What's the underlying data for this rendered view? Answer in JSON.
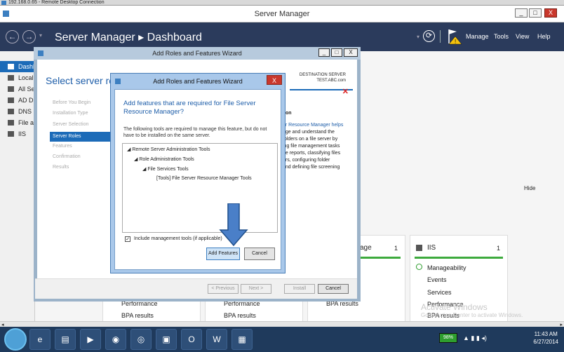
{
  "rdc": {
    "title": "192.168.0.65 - Remote Desktop Connection"
  },
  "window": {
    "title": "Server Manager",
    "min": "_",
    "max": "□",
    "close": "X"
  },
  "header": {
    "breadcrumb": "Server Manager ▸ Dashboard",
    "refresh_symbol": "⟳",
    "menu": [
      "Manage",
      "Tools",
      "View",
      "Help"
    ]
  },
  "sidebar": {
    "items": [
      "Dashboard",
      "Local Server",
      "All Servers",
      "AD DS",
      "DNS",
      "File and Storage Services",
      "IIS"
    ]
  },
  "main": {
    "hide": "Hide",
    "tiles": [
      {
        "title": "IIS",
        "count": "1",
        "rows": [
          "Manageability",
          "Events",
          "Services",
          "Performance",
          "BPA results"
        ]
      },
      {
        "title": "age",
        "count": "1"
      }
    ],
    "bottom_rows": [
      "Performance",
      "BPA results",
      "Performance",
      "BPA results",
      "BPA results"
    ]
  },
  "wizard": {
    "title": "Add Roles and Features Wizard",
    "heading": "Select server roles",
    "dest_label": "DESTINATION SERVER",
    "dest_value": "TEST.ABC.com",
    "steps": [
      "Before You Begin",
      "Installation Type",
      "Server Selection",
      "Server Roles",
      "Features",
      "Confirmation",
      "Results"
    ],
    "desc_heading": "ion",
    "desc_lines": [
      "er Resource Manager helps",
      "age and understand the",
      "folders on a file server by",
      "ing file management tasks",
      "ge reports, classifying files",
      "ers, configuring folder",
      "and defining file screening"
    ],
    "buttons": {
      "prev": "< Previous",
      "next": "Next >",
      "install": "Install",
      "cancel": "Cancel"
    }
  },
  "dialog": {
    "title": "Add Roles and Features Wizard",
    "close": "X",
    "heading": "Add features that are required for File Server Resource Manager?",
    "description": "The following tools are required to manage this feature, but do not have to be installed on the same server.",
    "tree": [
      "Remote Server Administration Tools",
      "Role Administration Tools",
      "File Services Tools",
      "[Tools] File Server Resource Manager Tools"
    ],
    "include_tools": "Include management tools (if applicable)",
    "add_button": "Add Features",
    "cancel_button": "Cancel"
  },
  "watermark": {
    "line1": "Activate Windows",
    "line2": "Go to Action Center to activate Windows."
  },
  "taskbar": {
    "battery": "98%",
    "time": "11:43 AM",
    "date": "6/27/2014"
  },
  "colors": {
    "accent": "#1c6bb8",
    "header": "#2b3b5c",
    "ok_green": "#3daa3d",
    "dialog_heading": "#1e5ea9"
  }
}
